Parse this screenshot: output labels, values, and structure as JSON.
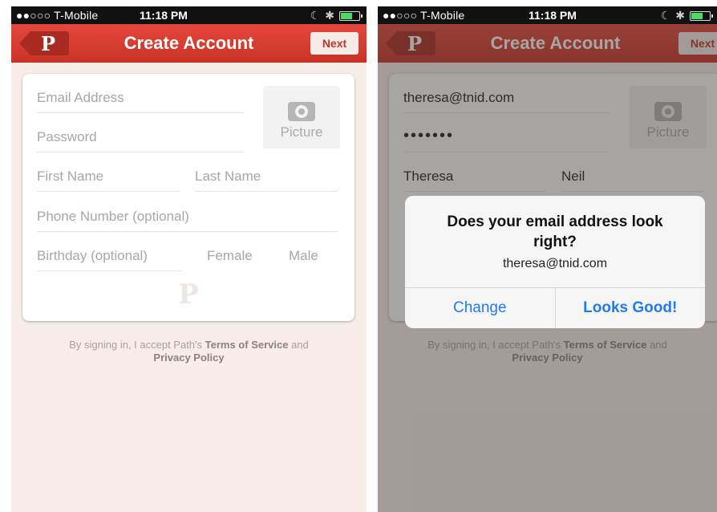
{
  "status": {
    "carrier": "●●○○○ T-Mobile",
    "time": "11:18 PM"
  },
  "nav": {
    "back_glyph": "P",
    "title": "Create Account",
    "next_label": "Next"
  },
  "form_left": {
    "email_placeholder": "Email Address",
    "password_placeholder": "Password",
    "first_name_placeholder": "First Name",
    "last_name_placeholder": "Last Name",
    "phone_placeholder": "Phone Number (optional)",
    "birthday_placeholder": "Birthday (optional)",
    "female_label": "Female",
    "male_label": "Male",
    "picture_label": "Picture"
  },
  "form_right": {
    "email_value": "theresa@tnid.com",
    "password_value": "•••••••",
    "first_name_value": "Theresa",
    "last_name_value": "Neil",
    "picture_label": "Picture"
  },
  "terms": {
    "prefix": "By signing in, I accept Path's ",
    "tos": "Terms of Service",
    "and": " and",
    "privacy": "Privacy Policy"
  },
  "alert": {
    "title": "Does your email address look right?",
    "message": "theresa@tnid.com",
    "change_label": "Change",
    "confirm_label": "Looks Good!"
  }
}
